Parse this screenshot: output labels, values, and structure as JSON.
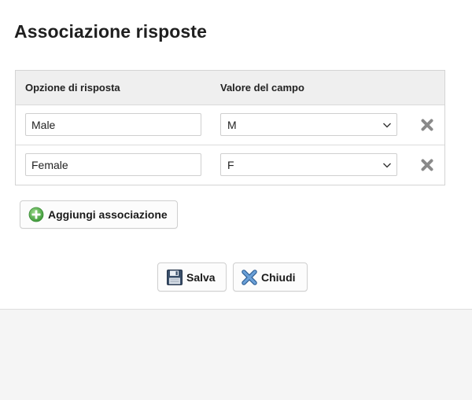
{
  "dialog": {
    "title": "Associazione risposte"
  },
  "table": {
    "headers": {
      "answer_option": "Opzione di risposta",
      "field_value": "Valore del campo"
    },
    "rows": [
      {
        "answer_option": "Male",
        "field_value": "M"
      },
      {
        "answer_option": "Female",
        "field_value": "F"
      }
    ]
  },
  "buttons": {
    "add_association": "Aggiungi associazione",
    "save": "Salva",
    "close": "Chiudi"
  },
  "icons": {
    "row_delete": "close-x-icon",
    "add": "plus-circle-icon",
    "save": "floppy-disk-icon",
    "close": "blue-x-icon",
    "select": "chevron-down-icon"
  },
  "colors": {
    "add_icon_green": "#5cb85c",
    "close_icon_blue": "#3d7ab8",
    "delete_icon_gray": "#8a8a8a",
    "header_bg": "#efefef",
    "footer_bg": "#f5f5f5"
  }
}
